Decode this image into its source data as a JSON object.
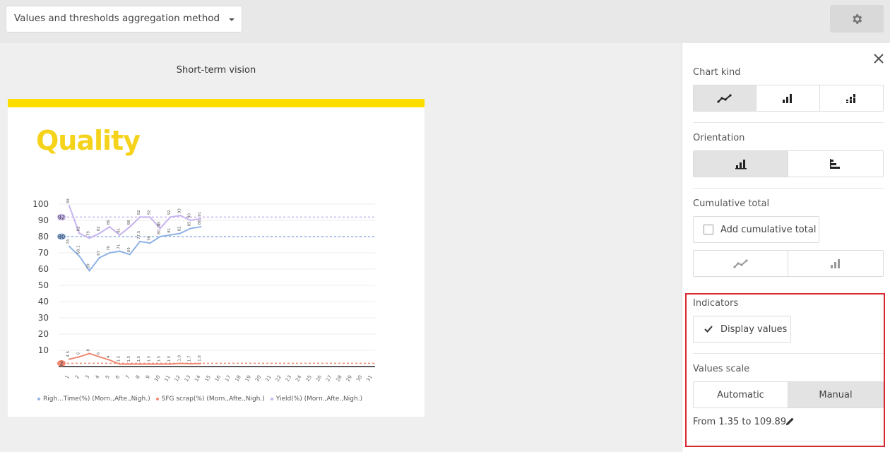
{
  "topbar": {
    "aggregation_select": "Values and thresholds aggregation method",
    "settings_icon": "gear-icon"
  },
  "chart_heading": "Short-term vision",
  "card": {
    "title": "Quality",
    "band_color": "#ffdd00",
    "title_color": "#f5d31b"
  },
  "chart_data": {
    "type": "line",
    "x": [
      1,
      2,
      3,
      4,
      5,
      6,
      7,
      8,
      9,
      10,
      11,
      12,
      13,
      14,
      15,
      16,
      17,
      18,
      19,
      20,
      21,
      22,
      23,
      24,
      25,
      26,
      27,
      28,
      29,
      30,
      31
    ],
    "y_ticks": [
      10,
      20,
      30,
      40,
      50,
      60,
      70,
      80,
      90,
      100
    ],
    "ylim": [
      0,
      100
    ],
    "series": [
      {
        "name": "Righ...Time(%) (Morn.,Afte.,Nigh.)",
        "color": "#8fb3e6",
        "values": [
          74,
          68,
          59,
          67,
          70,
          71,
          69,
          77,
          76,
          80,
          81,
          82,
          85,
          86
        ],
        "labels": [
          "74",
          "68.1",
          "59",
          "67",
          "70",
          "71",
          "69",
          "77.5",
          "76",
          "80.35",
          "81",
          "82",
          "85",
          "86"
        ],
        "threshold": 80
      },
      {
        "name": "SFG scrap(%) (Morn.,Afte.,Nigh.)",
        "color": "#f08a73",
        "values": [
          4.5,
          6,
          8,
          6,
          4,
          1.5,
          1.5,
          1.5,
          1.5,
          1.5,
          1.5,
          1.9,
          1.7,
          1.8
        ],
        "labels": [
          "4.5",
          "6",
          "8",
          "6",
          "4",
          "1.5",
          "1.5",
          "1.5",
          "1.5",
          "1.5",
          "1.5",
          "1.9",
          "1.7",
          "1.8"
        ],
        "threshold": 2
      },
      {
        "name": "Yield(%) (Morn.,Afte.,Nigh.)",
        "color": "#c7b3ef",
        "values": [
          99,
          82,
          79,
          82,
          86,
          81,
          86,
          92,
          92,
          85,
          92,
          93,
          90,
          91
        ],
        "labels": [
          "99",
          "82",
          "79",
          "82",
          "86",
          "81",
          "86",
          "92",
          "92",
          "85",
          "92",
          "93",
          "90",
          "91"
        ],
        "threshold": 92
      }
    ]
  },
  "panel": {
    "close_icon": "close-icon",
    "chart_kind_label": "Chart kind",
    "orientation_label": "Orientation",
    "cumulative_label": "Cumulative total",
    "add_cumulative": "Add cumulative total",
    "indicators_label": "Indicators",
    "display_values": "Display values",
    "values_scale_label": "Values scale",
    "scale_automatic": "Automatic",
    "scale_manual": "Manual",
    "scale_range": "From 1.35 to 109.89",
    "edit_icon": "pencil-icon"
  }
}
